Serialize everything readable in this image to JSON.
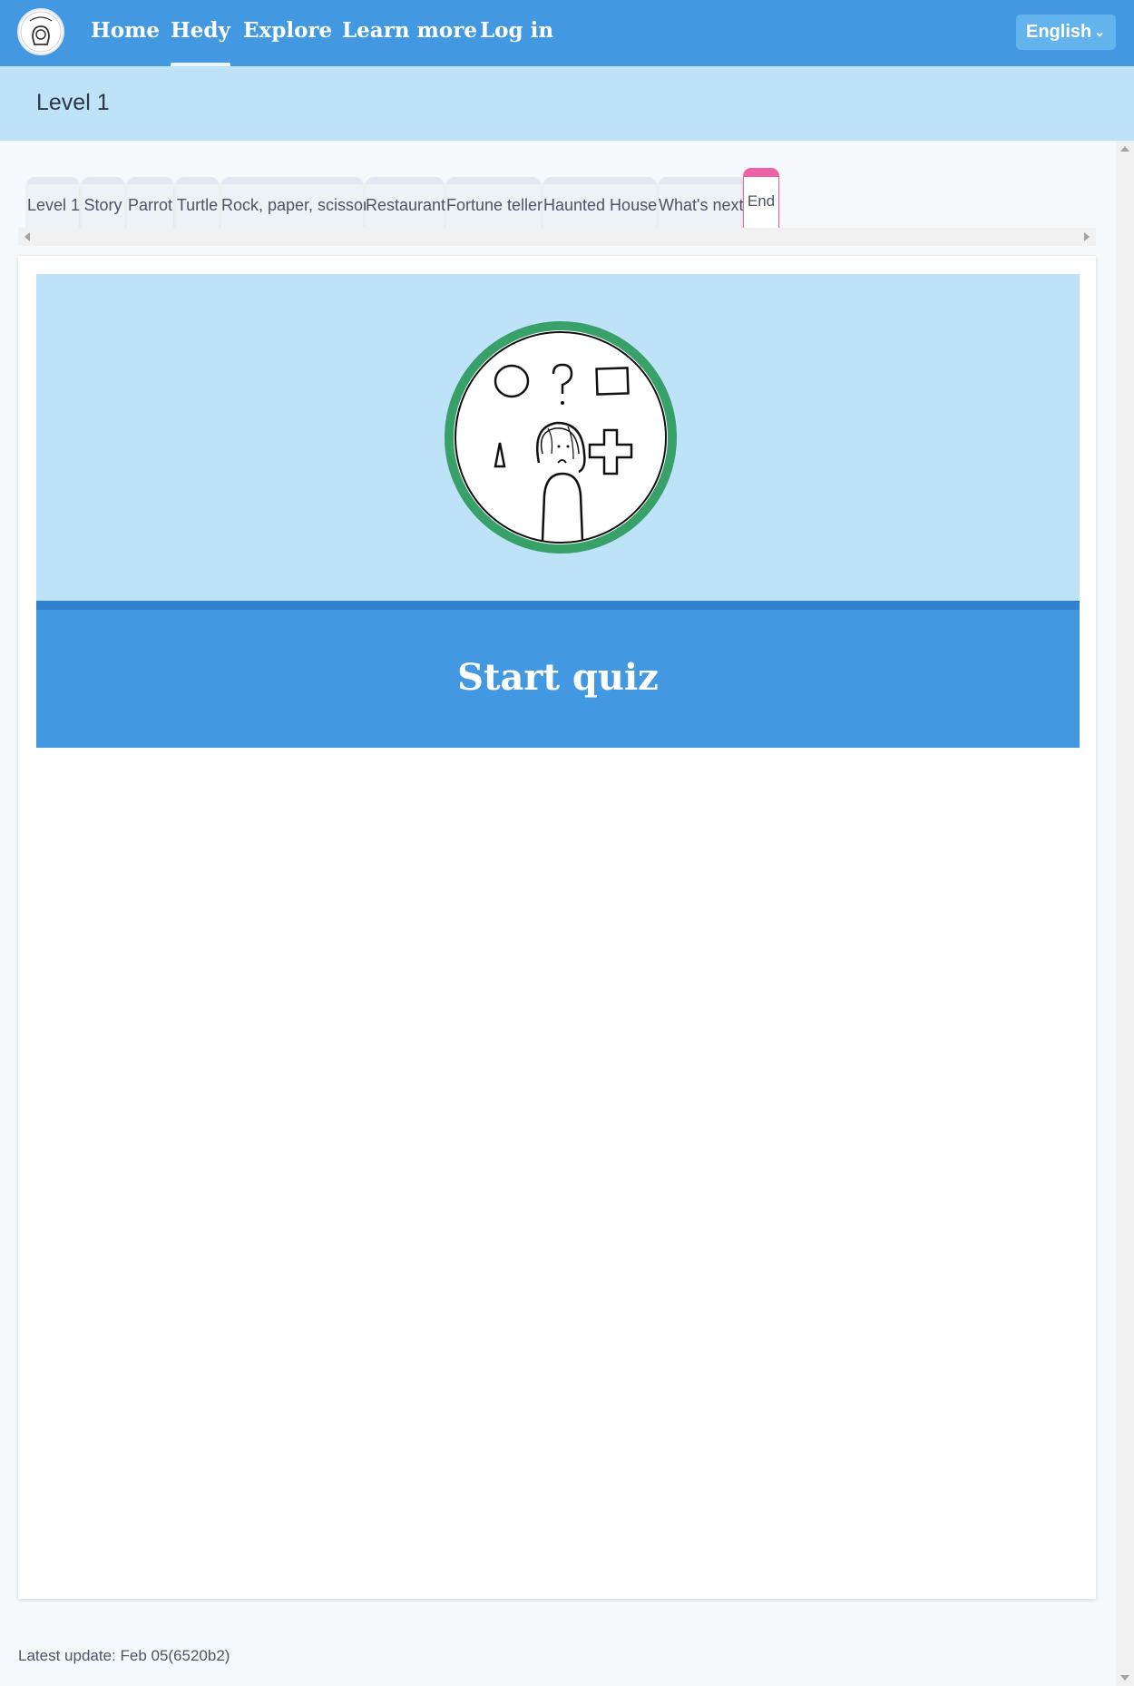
{
  "nav": {
    "items": [
      {
        "label": "Home"
      },
      {
        "label": "Hedy"
      },
      {
        "label": "Explore"
      },
      {
        "label": "Learn more"
      },
      {
        "label": "Log in"
      }
    ],
    "language": "English",
    "colors": {
      "nav_bg": "#4299e1",
      "banner_bg": "#bee3f8",
      "active_tab": "#ed64a6",
      "badge_ring": "#38a169"
    }
  },
  "level": {
    "title": "Level 1"
  },
  "tabs": [
    {
      "label": "Level 1"
    },
    {
      "label": "Story"
    },
    {
      "label": "Parrot"
    },
    {
      "label": "Turtle"
    },
    {
      "label": "Rock, paper, scissors"
    },
    {
      "label": "Restaurant"
    },
    {
      "label": "Fortune teller"
    },
    {
      "label": "Haunted House"
    },
    {
      "label": "What's next?"
    },
    {
      "label": "End"
    }
  ],
  "quiz": {
    "button_label": "Start quiz"
  },
  "footer": {
    "text": "Latest update: Feb 05(6520b2)"
  }
}
